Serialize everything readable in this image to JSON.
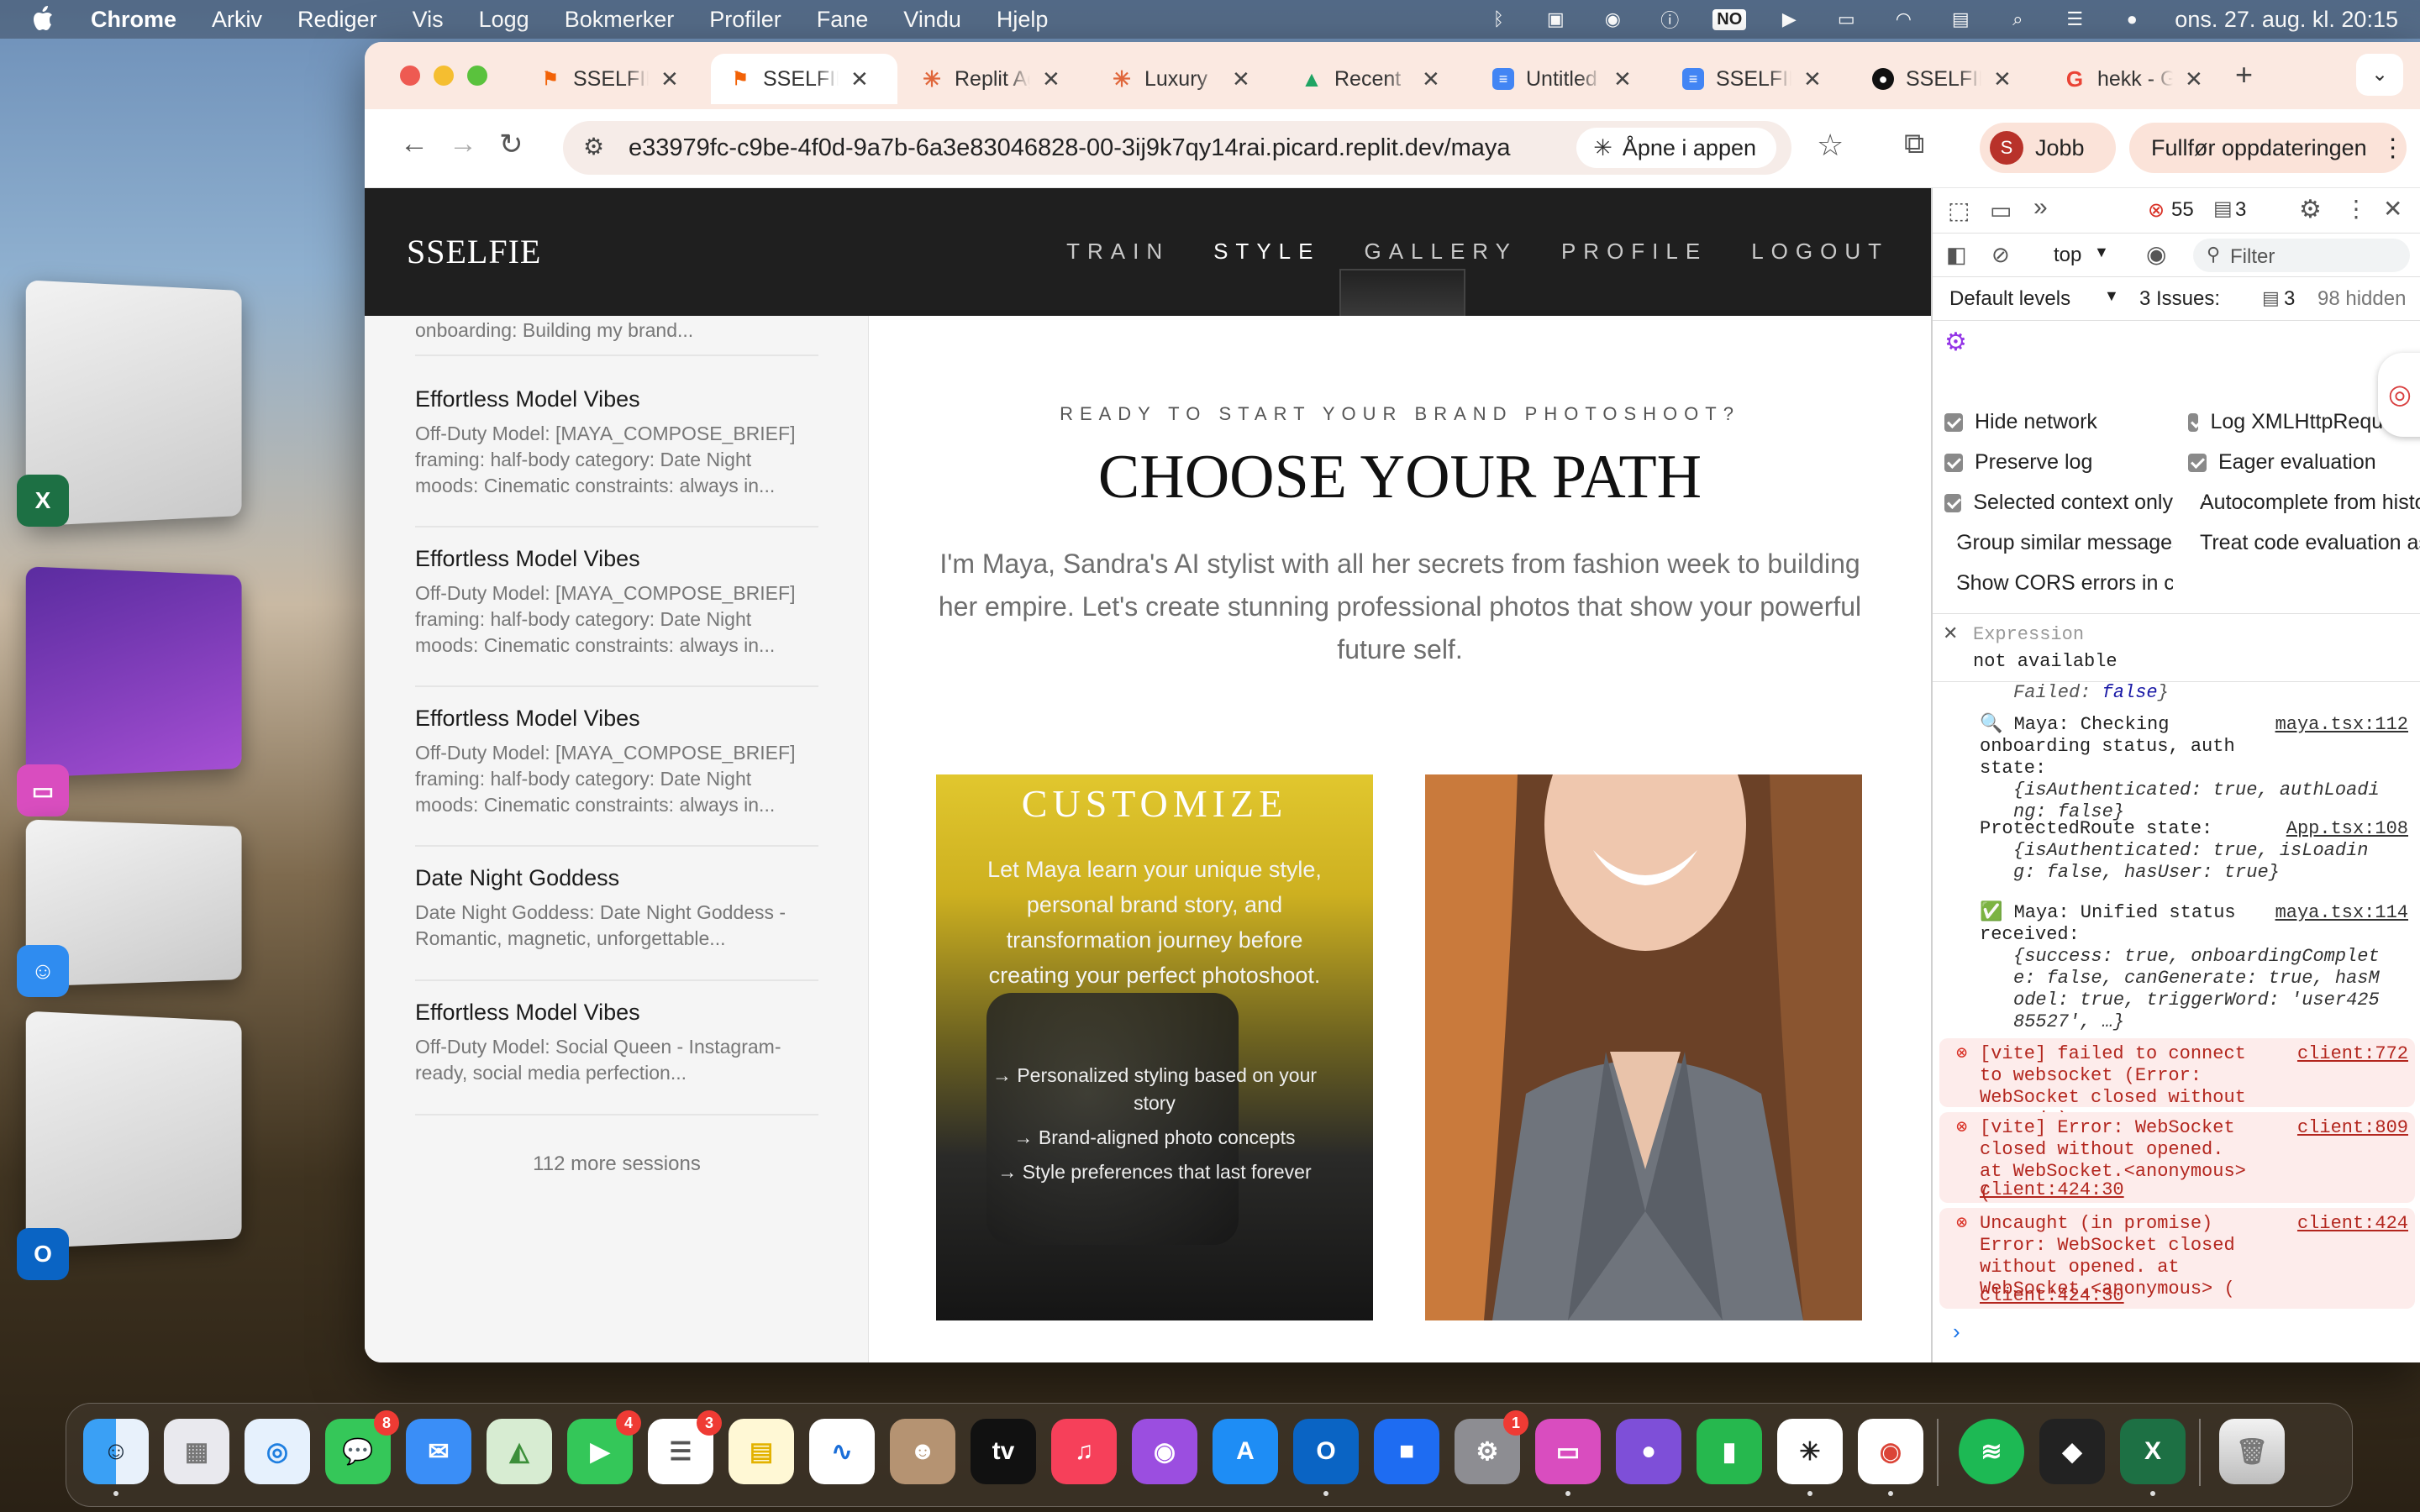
{
  "menubar": {
    "app": "Chrome",
    "items": [
      "Arkiv",
      "Rediger",
      "Vis",
      "Logg",
      "Bokmerker",
      "Profiler",
      "Fane",
      "Vindu",
      "Hjelp"
    ],
    "input_badge": "NO",
    "clock": "ons. 27. aug. kl. 20:15"
  },
  "tabs": [
    {
      "label": "SSELFIE",
      "icon": "replit-icon",
      "color": "#f26207"
    },
    {
      "label": "SSELFIE",
      "icon": "replit-icon",
      "color": "#f26207",
      "active": true
    },
    {
      "label": "Replit Agent",
      "icon": "sparkle-icon",
      "color": "#e0663a"
    },
    {
      "label": "Luxury",
      "icon": "sparkle-icon",
      "color": "#e0663a"
    },
    {
      "label": "Recent",
      "icon": "drive-icon",
      "color": "#1fa463"
    },
    {
      "label": "Untitled",
      "icon": "docs-icon",
      "color": "#4285f4"
    },
    {
      "label": "SSELFIE",
      "icon": "docs-icon",
      "color": "#4285f4"
    },
    {
      "label": "SSELFIE",
      "icon": "github-icon",
      "color": "#111111"
    },
    {
      "label": "hekk - Google",
      "icon": "google-icon",
      "color": "#ea4335"
    }
  ],
  "toolbar": {
    "url": "e33979fc-c9be-4f0d-9a7b-6a3e83046828-00-3ij9k7qy14rai.picard.replit.dev/maya",
    "open_in_app": "Åpne i appen",
    "profile_initial": "S",
    "profile_label": "Jobb",
    "update_label": "Fullfør oppdateringen"
  },
  "site": {
    "logo": "SSELFIE",
    "nav": [
      "TRAIN",
      "STYLE",
      "GALLERY",
      "PROFILE",
      "LOGOUT"
    ],
    "active_nav": "STYLE"
  },
  "sidebar": {
    "partial_desc": "onboarding: Building my brand...",
    "sessions": [
      {
        "title": "Effortless Model Vibes",
        "desc": "Off-Duty Model: [MAYA_COMPOSE_BRIEF] framing: half-body category: Date Night moods: Cinematic constraints: always in..."
      },
      {
        "title": "Effortless Model Vibes",
        "desc": "Off-Duty Model: [MAYA_COMPOSE_BRIEF] framing: half-body category: Date Night moods: Cinematic constraints: always in..."
      },
      {
        "title": "Effortless Model Vibes",
        "desc": "Off-Duty Model: [MAYA_COMPOSE_BRIEF] framing: half-body category: Date Night moods: Cinematic constraints: always in..."
      },
      {
        "title": "Date Night Goddess",
        "desc": "Date Night Goddess: Date Night Goddess - Romantic, magnetic, unforgettable..."
      },
      {
        "title": "Effortless Model Vibes",
        "desc": "Off-Duty Model: Social Queen - Instagram-ready, social media perfection..."
      }
    ],
    "more": "112 more sessions"
  },
  "main": {
    "kicker": "READY TO START YOUR BRAND PHOTOSHOOT?",
    "title": "CHOOSE YOUR PATH",
    "intro": "I'm Maya, Sandra's AI stylist with all her secrets from fashion week to building her empire. Let's create stunning professional photos that show your powerful future self.",
    "card1": {
      "heading": "CUSTOMIZE",
      "text": "Let Maya learn your unique style, personal brand story, and transformation journey before creating your perfect photoshoot.",
      "bullets": [
        "→ Personalized styling based on your story",
        "→ Brand-aligned photo concepts",
        "→ Style preferences that last forever"
      ]
    }
  },
  "devtools": {
    "error_count": "55",
    "issue_count": "3",
    "context": "top",
    "filter_placeholder": "Filter",
    "levels": "Default levels",
    "issues_label": "3 Issues:",
    "issues_num": "3",
    "hidden": "98 hidden",
    "settings": [
      [
        "Hide network",
        "Log XMLHttpRequests"
      ],
      [
        "Preserve log",
        "Eager evaluation"
      ],
      [
        "Selected context only",
        "Autocomplete from history"
      ],
      [
        "Group similar messages in console",
        "Treat code evaluation as user action"
      ],
      [
        "Show CORS errors in console",
        ""
      ]
    ],
    "expression_label": "Expression",
    "expression_value": "not available",
    "logs": [
      {
        "text": "🔍 Maya: Checking onboarding status, auth state:",
        "src": "maya.tsx:112",
        "detail": "{isAuthenticated: true, authLoading: false}"
      },
      {
        "text": "ProtectedRoute state:",
        "src": "App.tsx:108",
        "detail": "{isAuthenticated: true, isLoading: false, hasUser: true}"
      },
      {
        "text": "✅ Maya: Unified status received:",
        "src": "maya.tsx:114",
        "detail": "{success: true, onboardingComplete: false, canGenerate: true, hasModel: true, triggerWord: 'user42585527', …}"
      },
      {
        "text": "[vite] failed to connect to websocket (Error: WebSocket closed without opened.).",
        "src": "client:772",
        "error": true
      },
      {
        "text": "[vite] Error: WebSocket closed without opened. at WebSocket.<anonymous> (",
        "src": "client:809",
        "link2": "client:424:30",
        "error": true
      },
      {
        "text": "Uncaught (in promise) Error: WebSocket closed without opened. at WebSocket.<anonymous> (",
        "src": "client:424",
        "link2": "client:424:30",
        "error": true
      }
    ]
  },
  "dock": {
    "badges": {
      "messages": "8",
      "facetime": "4",
      "reminders": "3",
      "settings": "1"
    }
  }
}
